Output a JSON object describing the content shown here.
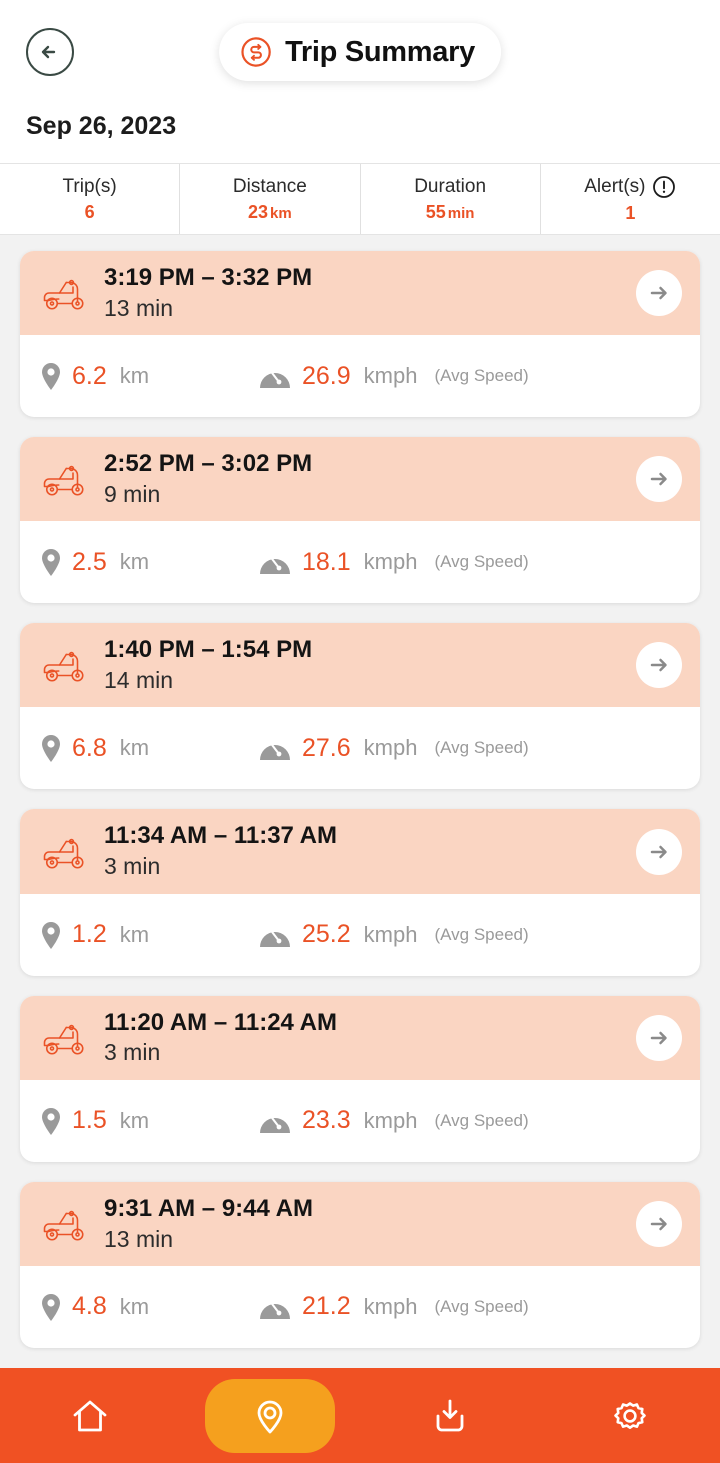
{
  "header": {
    "back_icon": "arrow-left-icon",
    "brand_icon": "sync-s-logo-icon",
    "title": "Trip Summary",
    "date": "Sep 26, 2023"
  },
  "stats": [
    {
      "label": "Trip(s)",
      "value": "6",
      "unit": "",
      "icon": ""
    },
    {
      "label": "Distance",
      "value": "23",
      "unit": "km",
      "icon": ""
    },
    {
      "label": "Duration",
      "value": "55",
      "unit": "min",
      "icon": ""
    },
    {
      "label": "Alert(s)",
      "value": "1",
      "unit": "",
      "icon": "exclamation-circle-icon"
    }
  ],
  "trips": [
    {
      "range": "3:19 PM – 3:32 PM",
      "duration": "13 min",
      "distance": "6.2",
      "distance_unit": "km",
      "speed": "26.9",
      "speed_unit": "kmph",
      "speed_note": "(Avg Speed)"
    },
    {
      "range": "2:52 PM – 3:02 PM",
      "duration": "9 min",
      "distance": "2.5",
      "distance_unit": "km",
      "speed": "18.1",
      "speed_unit": "kmph",
      "speed_note": "(Avg Speed)"
    },
    {
      "range": "1:40 PM – 1:54 PM",
      "duration": "14 min",
      "distance": "6.8",
      "distance_unit": "km",
      "speed": "27.6",
      "speed_unit": "kmph",
      "speed_note": "(Avg Speed)"
    },
    {
      "range": "11:34 AM – 11:37 AM",
      "duration": "3 min",
      "distance": "1.2",
      "distance_unit": "km",
      "speed": "25.2",
      "speed_unit": "kmph",
      "speed_note": "(Avg Speed)"
    },
    {
      "range": "11:20 AM – 11:24 AM",
      "duration": "3 min",
      "distance": "1.5",
      "distance_unit": "km",
      "speed": "23.3",
      "speed_unit": "kmph",
      "speed_note": "(Avg Speed)"
    },
    {
      "range": "9:31 AM – 9:44 AM",
      "duration": "13 min",
      "distance": "4.8",
      "distance_unit": "km",
      "speed": "21.2",
      "speed_unit": "kmph",
      "speed_note": "(Avg Speed)"
    }
  ],
  "bottom_nav": [
    {
      "icon": "home-icon",
      "active": false
    },
    {
      "icon": "location-pin-icon",
      "active": true
    },
    {
      "icon": "download-inbox-icon",
      "active": false
    },
    {
      "icon": "gear-icon",
      "active": false
    }
  ],
  "colors": {
    "accent_orange": "#ea5226",
    "nav_bar": "#f05123",
    "nav_active": "#f5a01e",
    "card_header_pink": "#fad5c2",
    "page_bg": "#f2f2f2",
    "muted_gray": "#9a9a9a"
  }
}
